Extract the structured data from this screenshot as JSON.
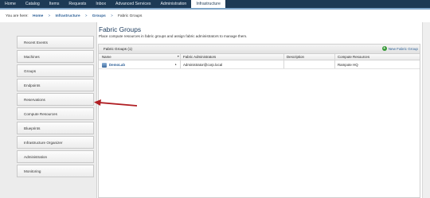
{
  "topnav": {
    "tabs": [
      {
        "label": "Home"
      },
      {
        "label": "Catalog"
      },
      {
        "label": "Items"
      },
      {
        "label": "Requests"
      },
      {
        "label": "Inbox"
      },
      {
        "label": "Advanced Services"
      },
      {
        "label": "Administration"
      },
      {
        "label": "Infrastructure",
        "active": true
      }
    ]
  },
  "breadcrumb": {
    "prefix": "You are here:",
    "items": [
      "Home",
      "Infrastructure",
      "Groups",
      "Fabric Groups"
    ],
    "separator": ">"
  },
  "sidebar": {
    "items": [
      {
        "label": "Recent Events"
      },
      {
        "label": "Machines"
      },
      {
        "label": "Groups"
      },
      {
        "label": "Endpoints"
      },
      {
        "label": "Reservations"
      },
      {
        "label": "Compute Resources"
      },
      {
        "label": "Blueprints"
      },
      {
        "label": "Infrastructure Organizer"
      },
      {
        "label": "Administration"
      },
      {
        "label": "Monitoring"
      }
    ]
  },
  "main": {
    "title": "Fabric Groups",
    "description": "Place compute resources in fabric groups and assign fabric administrators to manage them.",
    "grid": {
      "title": "Fabric Groups (1)",
      "new_button": "New Fabric Group",
      "columns": [
        "Name",
        "Fabric Administrators",
        "Description",
        "Compute Resources"
      ],
      "rows": [
        {
          "name": "DemoLab",
          "administrators": "Administrator@corp.local",
          "description": "",
          "compute_resources": "Rampote HQ"
        }
      ]
    }
  },
  "colors": {
    "nav_background": "#1d3a55",
    "link": "#2d5f96",
    "annotation_arrow": "#b01e23",
    "add_icon": "#3a9b3a"
  }
}
